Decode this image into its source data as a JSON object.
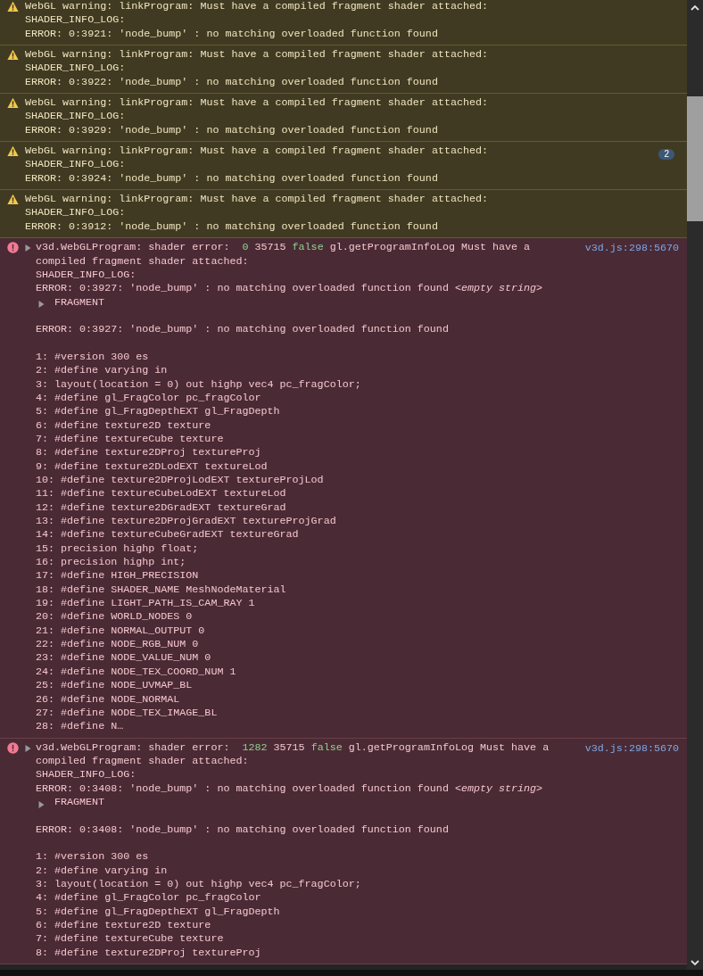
{
  "console": {
    "messages": [
      {
        "kind": "warning",
        "lines": [
          "WebGL warning: linkProgram: Must have a compiled fragment shader attached:",
          "SHADER_INFO_LOG:",
          "ERROR: 0:3921: 'node_bump' : no matching overloaded function found"
        ]
      },
      {
        "kind": "warning",
        "lines": [
          "WebGL warning: linkProgram: Must have a compiled fragment shader attached:",
          "SHADER_INFO_LOG:",
          "ERROR: 0:3922: 'node_bump' : no matching overloaded function found"
        ]
      },
      {
        "kind": "warning",
        "lines": [
          "WebGL warning: linkProgram: Must have a compiled fragment shader attached:",
          "SHADER_INFO_LOG:",
          "ERROR: 0:3929: 'node_bump' : no matching overloaded function found"
        ]
      },
      {
        "kind": "warning",
        "count": "2",
        "lines": [
          "WebGL warning: linkProgram: Must have a compiled fragment shader attached:",
          "SHADER_INFO_LOG:",
          "ERROR: 0:3924: 'node_bump' : no matching overloaded function found"
        ]
      },
      {
        "kind": "warning",
        "lines": [
          "WebGL warning: linkProgram: Must have a compiled fragment shader attached:",
          "SHADER_INFO_LOG:",
          "ERROR: 0:3912: 'node_bump' : no matching overloaded function found"
        ]
      },
      {
        "kind": "error",
        "expanded": false,
        "source": "v3d.js:298:5670",
        "parts": [
          {
            "kind": "plain",
            "text": "v3d.WebGLProgram: shader error:  "
          },
          {
            "kind": "literal",
            "text": "0"
          },
          {
            "kind": "plain",
            "text": " 35715 "
          },
          {
            "kind": "literal",
            "text": "false"
          },
          {
            "kind": "plain",
            "text": " gl.getProgramInfoLog Must have a compiled fragment shader attached:\nSHADER_INFO_LOG:\nERROR: 0:3927: 'node_bump' : no matching overloaded function found "
          },
          {
            "kind": "empty",
            "text": "<empty string>"
          }
        ],
        "fragment": {
          "label": "FRAGMENT",
          "expanded": false
        },
        "error_line": "ERROR: 0:3927: 'node_bump' : no matching overloaded function found",
        "code_lines": [
          "1: #version 300 es",
          "2: #define varying in",
          "3: layout(location = 0) out highp vec4 pc_fragColor;",
          "4: #define gl_FragColor pc_fragColor",
          "5: #define gl_FragDepthEXT gl_FragDepth",
          "6: #define texture2D texture",
          "7: #define textureCube texture",
          "8: #define texture2DProj textureProj",
          "9: #define texture2DLodEXT textureLod",
          "10: #define texture2DProjLodEXT textureProjLod",
          "11: #define textureCubeLodEXT textureLod",
          "12: #define texture2DGradEXT textureGrad",
          "13: #define texture2DProjGradEXT textureProjGrad",
          "14: #define textureCubeGradEXT textureGrad",
          "15: precision highp float;",
          "16: precision highp int;",
          "17: #define HIGH_PRECISION",
          "18: #define SHADER_NAME MeshNodeMaterial",
          "19: #define LIGHT_PATH_IS_CAM_RAY 1",
          "20: #define WORLD_NODES 0",
          "21: #define NORMAL_OUTPUT 0",
          "22: #define NODE_RGB_NUM 0",
          "23: #define NODE_VALUE_NUM 0",
          "24: #define NODE_TEX_COORD_NUM 1",
          "25: #define NODE_UVMAP_BL",
          "26: #define NODE_NORMAL",
          "27: #define NODE_TEX_IMAGE_BL",
          "28: #define N…"
        ]
      },
      {
        "kind": "error",
        "expanded": false,
        "source": "v3d.js:298:5670",
        "parts": [
          {
            "kind": "plain",
            "text": "v3d.WebGLProgram: shader error:  "
          },
          {
            "kind": "literal",
            "text": "1282"
          },
          {
            "kind": "plain",
            "text": " 35715 "
          },
          {
            "kind": "literal",
            "text": "false"
          },
          {
            "kind": "plain",
            "text": " gl.getProgramInfoLog Must have a compiled fragment shader attached:\nSHADER_INFO_LOG:\nERROR: 0:3408: 'node_bump' : no matching overloaded function found "
          },
          {
            "kind": "empty",
            "text": "<empty string>"
          }
        ],
        "fragment": {
          "label": "FRAGMENT",
          "expanded": false
        },
        "error_line": "ERROR: 0:3408: 'node_bump' : no matching overloaded function found",
        "code_lines": [
          "1: #version 300 es",
          "2: #define varying in",
          "3: layout(location = 0) out highp vec4 pc_fragColor;",
          "4: #define gl_FragColor pc_fragColor",
          "5: #define gl_FragDepthEXT gl_FragDepth",
          "6: #define texture2D texture",
          "7: #define textureCube texture",
          "8: #define texture2DProj textureProj"
        ]
      }
    ]
  }
}
